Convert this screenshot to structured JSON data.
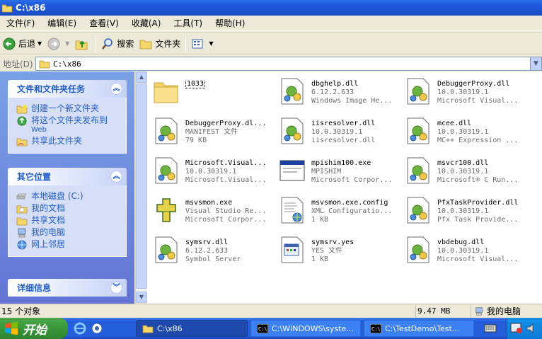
{
  "window": {
    "title": "C:\\x86"
  },
  "menu": [
    "文件(F)",
    "编辑(E)",
    "查看(V)",
    "收藏(A)",
    "工具(T)",
    "帮助(H)"
  ],
  "toolbar": {
    "back": "后退",
    "search": "搜索",
    "folders": "文件夹"
  },
  "address": {
    "label": "地址(D)",
    "value": "C:\\x86"
  },
  "task_panels": {
    "file_tasks": {
      "title": "文件和文件夹任务",
      "items": [
        "创建一个新文件夹",
        "将这个文件夹发布到",
        "Web",
        "共享此文件夹"
      ]
    },
    "other_places": {
      "title": "其它位置",
      "items": [
        "本地磁盘 (C:)",
        "我的文档",
        "共享文档",
        "我的电脑",
        "网上邻居"
      ]
    },
    "details": {
      "title": "详细信息"
    }
  },
  "files": [
    {
      "name": "1033",
      "line2": "",
      "line3": "",
      "icon": "folder-icon"
    },
    {
      "name": "dbghelp.dll",
      "line2": "6.12.2.633",
      "line3": "Windows Image He...",
      "icon": "dll-icon"
    },
    {
      "name": "DebuggerProxy.dll",
      "line2": "10.0.30319.1",
      "line3": "Microsoft Visual...",
      "icon": "dll-icon"
    },
    {
      "name": "DebuggerProxy.dl...",
      "line2": "MANIFEST 文件",
      "line3": "79 KB",
      "icon": "dll-icon"
    },
    {
      "name": "iisresolver.dll",
      "line2": "10.0.30319.1",
      "line3": "iisresolver.dll",
      "icon": "dll-icon"
    },
    {
      "name": "mcee.dll",
      "line2": "10.0.30319.1",
      "line3": "MC++ Expression ...",
      "icon": "dll-icon"
    },
    {
      "name": "Microsoft.Visual...",
      "line2": "10.0.30319.1",
      "line3": "Microsoft.Visual...",
      "icon": "dll-icon"
    },
    {
      "name": "mpishim100.exe",
      "line2": "MPISHIM",
      "line3": "Microsoft Corpor...",
      "icon": "app-window-icon"
    },
    {
      "name": "msvcr100.dll",
      "line2": "10.0.30319.1",
      "line3": "Microsoft® C Run...",
      "icon": "dll-icon"
    },
    {
      "name": "msvsmon.exe",
      "line2": "Visual Studio Re...",
      "line3": "Microsoft Corpor...",
      "icon": "puzzle-icon"
    },
    {
      "name": "msvsmon.exe.config",
      "line2": "XML Configuratio...",
      "line3": "1 KB",
      "icon": "config-icon"
    },
    {
      "name": "PfxTaskProvider.dll",
      "line2": "10.0.30319.1",
      "line3": "Pfx Task Provide...",
      "icon": "dll-icon"
    },
    {
      "name": "symsrv.dll",
      "line2": "6.12.2.633",
      "line3": "Symbol Server",
      "icon": "dll-icon"
    },
    {
      "name": "symsrv.yes",
      "line2": "YES 文件",
      "line3": "1 KB",
      "icon": "unknown-file-icon"
    },
    {
      "name": "vbdebug.dll",
      "line2": "10.0.30319.1",
      "line3": "Microsoft Visual...",
      "icon": "dll-icon"
    }
  ],
  "status": {
    "count": "15 个对象",
    "size": "9.47 MB",
    "location": "我的电脑"
  },
  "taskbar": {
    "start": "开始",
    "tasks": [
      "C:\\x86",
      "C:\\WINDOWS\\syste...",
      "C:\\TestDemo\\Test..."
    ]
  },
  "colors": {
    "title_blue": "#1F57D9",
    "pane_blue": "#6375D6",
    "link_blue": "#215DC6",
    "start_green": "#3C9A3C"
  }
}
